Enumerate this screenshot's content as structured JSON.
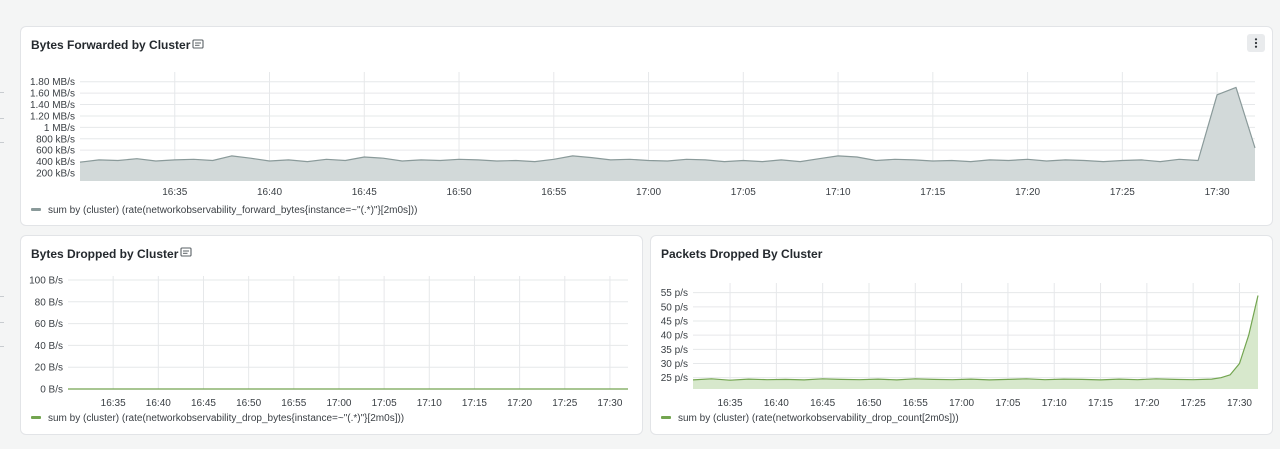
{
  "colors": {
    "forward_line": "#8a9a9a",
    "forward_fill": "#d2d9d9",
    "drop_line": "#73a550",
    "drop_fill": "#d7e8cc",
    "grid": "#e6e8ea",
    "panel_bg": "#ffffff",
    "page_bg": "#f4f5f5"
  },
  "icons": {
    "title_icon": "document-icon",
    "menu_icon": "vertical-ellipsis-icon"
  },
  "panels": [
    {
      "title": "Bytes Forwarded by Cluster",
      "legend": "sum by (cluster) (rate(networkobservability_forward_bytes{instance=~\"(.*)\"}[2m0s]))"
    },
    {
      "title": "Bytes Dropped by Cluster",
      "legend": "sum by (cluster) (rate(networkobservability_drop_bytes{instance=~\"(.*)\"}[2m0s]))"
    },
    {
      "title": "Packets Dropped By Cluster",
      "legend": "sum by (cluster) (rate(networkobservability_drop_count[2m0s]))"
    }
  ],
  "chart_data": [
    {
      "type": "area",
      "title": "Bytes Forwarded by Cluster",
      "xlabel": "",
      "ylabel": "",
      "y_unit": "kB/s",
      "yticks": [
        200,
        400,
        600,
        800,
        1000,
        1200,
        1400,
        1600,
        1800
      ],
      "ytick_labels": [
        "200 kB/s",
        "400 kB/s",
        "600 kB/s",
        "800 kB/s",
        "1 MB/s",
        "1.20 MB/s",
        "1.40 MB/s",
        "1.60 MB/s",
        "1.80 MB/s"
      ],
      "ylim": [
        60,
        1900
      ],
      "xlim": [
        "16:30",
        "17:32"
      ],
      "xticks": [
        "16:35",
        "16:40",
        "16:45",
        "16:50",
        "16:55",
        "17:00",
        "17:05",
        "17:10",
        "17:15",
        "17:20",
        "17:25",
        "17:30"
      ],
      "grid": true,
      "legend_position": "bottom-left",
      "series": [
        {
          "x": [
            "16:30",
            "16:31",
            "16:32",
            "16:33",
            "16:34",
            "16:35",
            "16:36",
            "16:37",
            "16:38",
            "16:39",
            "16:40",
            "16:41",
            "16:42",
            "16:43",
            "16:44",
            "16:45",
            "16:46",
            "16:47",
            "16:48",
            "16:49",
            "16:50",
            "16:51",
            "16:52",
            "16:53",
            "16:54",
            "16:55",
            "16:56",
            "16:57",
            "16:58",
            "16:59",
            "17:00",
            "17:01",
            "17:02",
            "17:03",
            "17:04",
            "17:05",
            "17:06",
            "17:07",
            "17:08",
            "17:09",
            "17:10",
            "17:11",
            "17:12",
            "17:13",
            "17:14",
            "17:15",
            "17:16",
            "17:17",
            "17:18",
            "17:19",
            "17:20",
            "17:21",
            "17:22",
            "17:23",
            "17:24",
            "17:25",
            "17:26",
            "17:27",
            "17:28",
            "17:29",
            "17:30",
            "17:31",
            "17:32"
          ],
          "values": [
            390,
            430,
            420,
            450,
            410,
            430,
            440,
            420,
            500,
            460,
            410,
            430,
            400,
            440,
            420,
            480,
            460,
            410,
            430,
            420,
            440,
            430,
            410,
            420,
            400,
            440,
            500,
            470,
            430,
            440,
            420,
            410,
            440,
            430,
            400,
            420,
            400,
            430,
            400,
            450,
            500,
            480,
            420,
            440,
            430,
            410,
            420,
            400,
            430,
            420,
            440,
            410,
            430,
            420,
            400,
            420,
            430,
            400,
            440,
            420,
            1570,
            1700,
            640
          ]
        }
      ]
    },
    {
      "type": "area",
      "title": "Bytes Dropped by Cluster",
      "xlabel": "",
      "ylabel": "",
      "y_unit": "B/s",
      "yticks": [
        0,
        20,
        40,
        60,
        80,
        100
      ],
      "ytick_labels": [
        "0 B/s",
        "20 B/s",
        "40 B/s",
        "60 B/s",
        "80 B/s",
        "100 B/s"
      ],
      "ylim": [
        0,
        100
      ],
      "xlim": [
        "16:30",
        "17:32"
      ],
      "xticks": [
        "16:35",
        "16:40",
        "16:45",
        "16:50",
        "16:55",
        "17:00",
        "17:05",
        "17:10",
        "17:15",
        "17:20",
        "17:25",
        "17:30"
      ],
      "grid": true,
      "legend_position": "bottom-left",
      "series": [
        {
          "x": [
            "16:30",
            "17:32"
          ],
          "values": [
            0,
            0
          ]
        }
      ]
    },
    {
      "type": "area",
      "title": "Packets Dropped By Cluster",
      "xlabel": "",
      "ylabel": "",
      "y_unit": "p/s",
      "yticks": [
        25,
        30,
        35,
        40,
        45,
        50,
        55
      ],
      "ytick_labels": [
        "25 p/s",
        "30 p/s",
        "35 p/s",
        "40 p/s",
        "45 p/s",
        "50 p/s",
        "55 p/s"
      ],
      "ylim": [
        21,
        57
      ],
      "xlim": [
        "16:31",
        "17:32"
      ],
      "xticks": [
        "16:35",
        "16:40",
        "16:45",
        "16:50",
        "16:55",
        "17:00",
        "17:05",
        "17:10",
        "17:15",
        "17:20",
        "17:25",
        "17:30"
      ],
      "grid": true,
      "legend_position": "bottom-left",
      "series": [
        {
          "x": [
            "16:31",
            "16:33",
            "16:35",
            "16:37",
            "16:39",
            "16:41",
            "16:43",
            "16:45",
            "16:47",
            "16:49",
            "16:51",
            "16:53",
            "16:55",
            "16:57",
            "16:59",
            "17:01",
            "17:03",
            "17:05",
            "17:07",
            "17:09",
            "17:11",
            "17:13",
            "17:15",
            "17:17",
            "17:19",
            "17:21",
            "17:23",
            "17:25",
            "17:27",
            "17:28",
            "17:29",
            "17:30",
            "17:31",
            "17:32"
          ],
          "values": [
            24.2,
            24.6,
            24.1,
            24.5,
            24.3,
            24.4,
            24.2,
            24.6,
            24.4,
            24.3,
            24.5,
            24.2,
            24.6,
            24.4,
            24.3,
            24.5,
            24.2,
            24.4,
            24.6,
            24.3,
            24.5,
            24.4,
            24.2,
            24.5,
            24.3,
            24.6,
            24.4,
            24.3,
            24.5,
            25,
            26,
            30,
            40,
            54
          ]
        }
      ]
    }
  ]
}
